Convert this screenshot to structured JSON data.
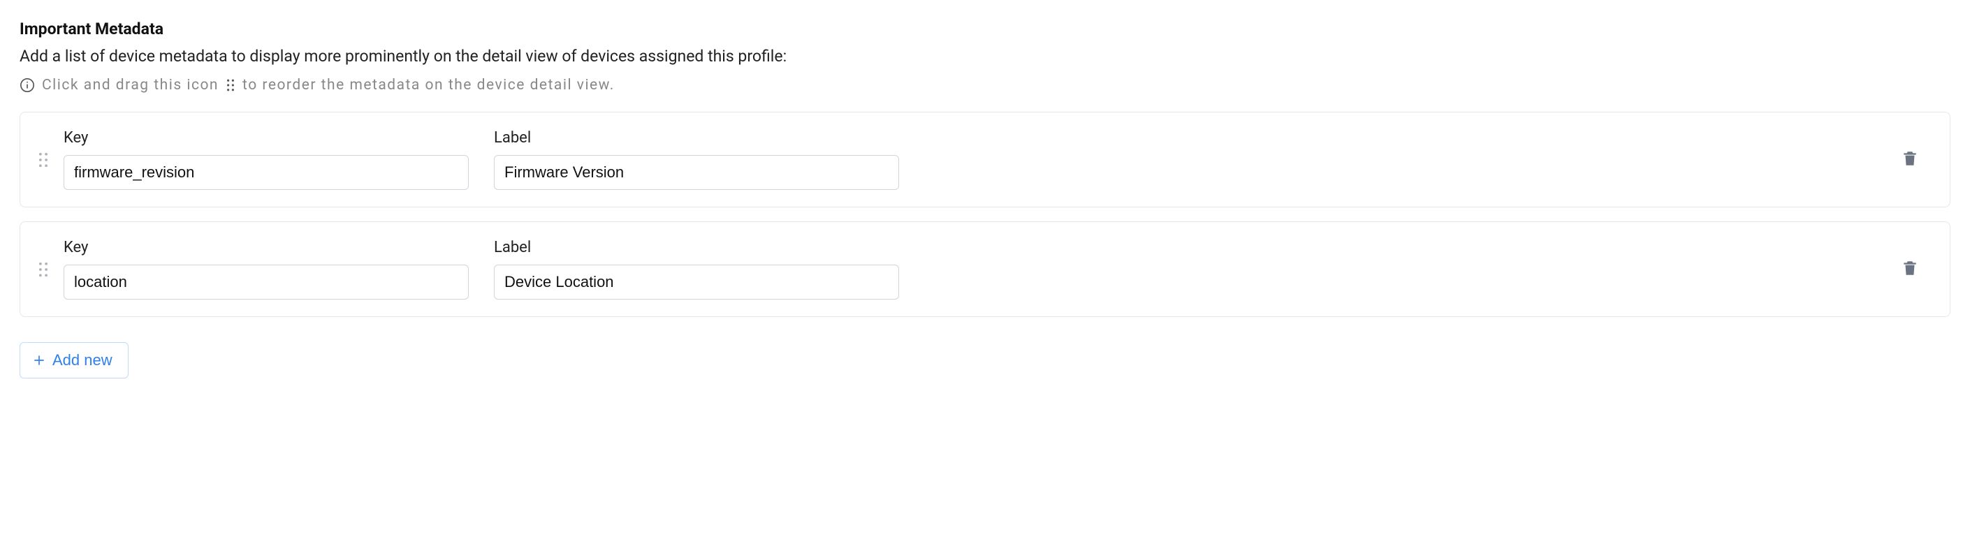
{
  "section": {
    "title": "Important Metadata",
    "description": "Add a list of device metadata to display more prominently on the detail view of devices assigned this profile:",
    "hint_prefix": "Click and drag this icon",
    "hint_suffix": "to reorder the metadata on the device detail view."
  },
  "labels": {
    "key": "Key",
    "label": "Label"
  },
  "rows": [
    {
      "key": "firmware_revision",
      "label": "Firmware Version"
    },
    {
      "key": "location",
      "label": "Device Location"
    }
  ],
  "actions": {
    "add_new": "Add new"
  }
}
